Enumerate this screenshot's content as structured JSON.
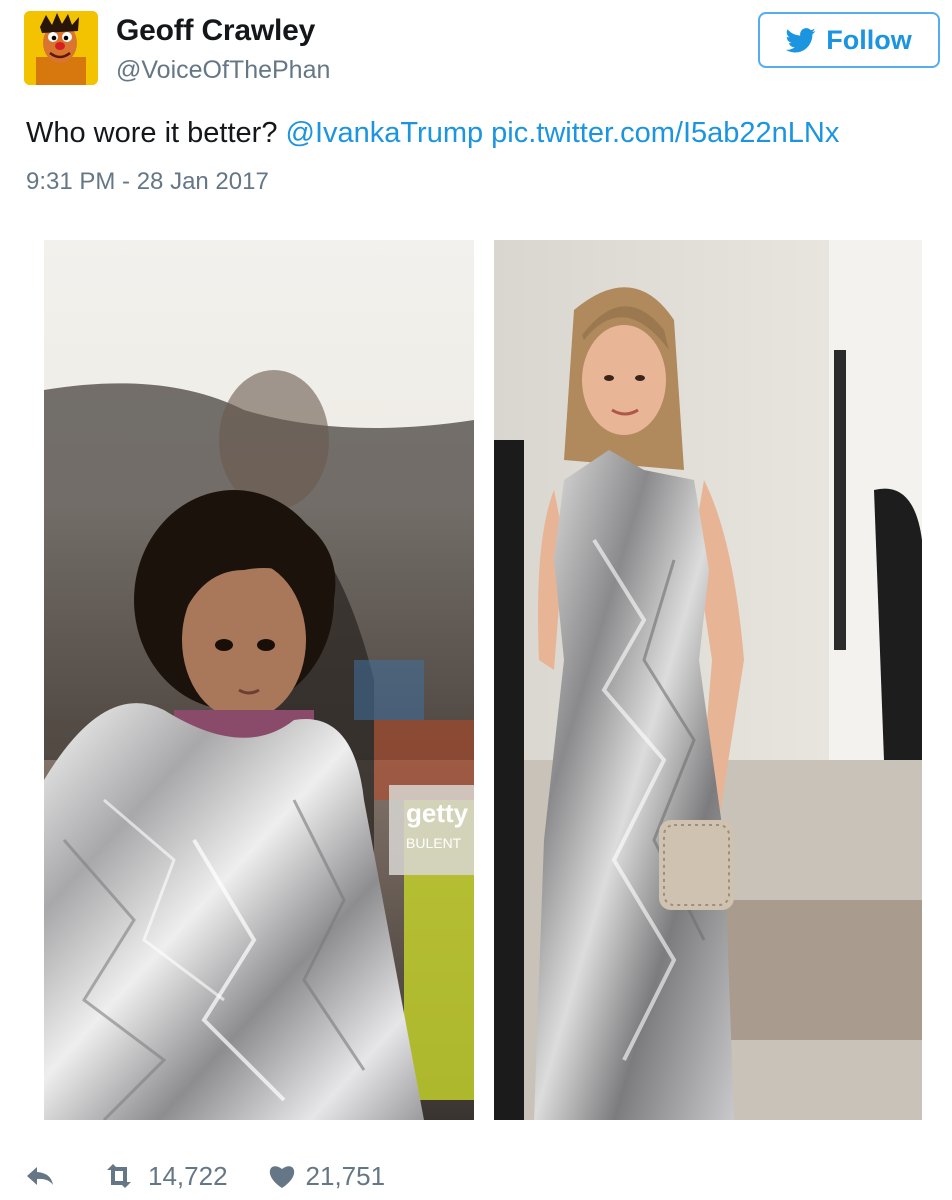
{
  "author": {
    "name": "Geoff Crawley",
    "handle": "@VoiceOfThePhan",
    "avatar_icon": "muppet-avatar-icon"
  },
  "follow_button": {
    "label": "Follow",
    "icon": "twitter-bird-icon",
    "color": "#1b95e0"
  },
  "tweet": {
    "text": "Who wore it better?",
    "mention": "@IvankaTrump",
    "link": "pic.twitter.com/I5ab22nLNx",
    "timestamp": "9:31 PM - 28 Jan 2017"
  },
  "photos": [
    {
      "name": "refugee-child-photo",
      "watermark": "getty",
      "watermark_sub": "BULENT"
    },
    {
      "name": "silver-dress-photo"
    }
  ],
  "actions": {
    "reply_icon": "reply-icon",
    "retweet_icon": "retweet-icon",
    "retweet_count": "14,722",
    "like_icon": "heart-icon",
    "like_count": "21,751"
  },
  "colors": {
    "link": "#1b95e0",
    "muted": "#657786",
    "text": "#14171a"
  }
}
